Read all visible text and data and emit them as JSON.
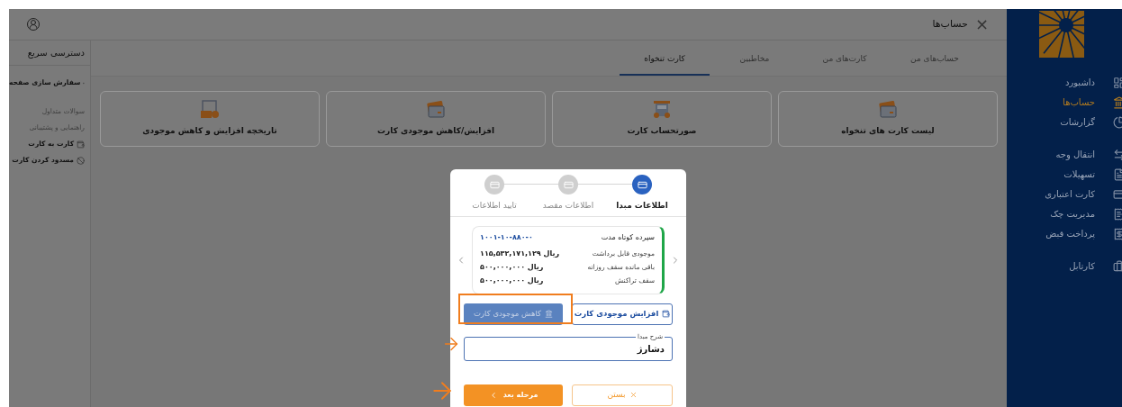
{
  "sidebar": {
    "groups": [
      [
        {
          "label": "داشبورد",
          "selected": false
        },
        {
          "label": "حساب‌ها",
          "selected": true
        },
        {
          "label": "گزارشات",
          "selected": false
        }
      ],
      [
        {
          "label": "انتقال وجه",
          "selected": false
        },
        {
          "label": "تسهیلات",
          "selected": false
        },
        {
          "label": "کارت اعتباری",
          "selected": false
        },
        {
          "label": "مدیریت چک",
          "selected": false
        },
        {
          "label": "پرداخت قبض",
          "selected": false
        }
      ],
      [
        {
          "label": "کارتابل",
          "selected": false
        }
      ]
    ]
  },
  "header": {
    "title": "حساب‌ها",
    "close": "×"
  },
  "tabs": [
    {
      "label": "حساب‌های من",
      "selected": false
    },
    {
      "label": "کارت‌های من",
      "selected": false
    },
    {
      "label": "مخاطبین",
      "selected": false
    },
    {
      "label": "کارت تنخواه",
      "selected": true
    }
  ],
  "cards": [
    {
      "label": "لیست کارت های تنخواه"
    },
    {
      "label": "صورتحساب کارت"
    },
    {
      "label": "افزایش/کاهش موجودی کارت"
    },
    {
      "label": "تاریخچه افزایش و کاهش موجودی"
    }
  ],
  "quick_access": {
    "title": "دسترسی سریع",
    "items": [
      {
        "label": "سفارش سازی صفحه",
        "disabled": false
      },
      {
        "label": "سوالات متداول",
        "disabled": true
      },
      {
        "label": "راهنمایی و پشتیبانی",
        "disabled": true
      },
      {
        "label": "کارت به کارت",
        "disabled": false
      },
      {
        "label": "مسدود کردن کارت",
        "disabled": false
      }
    ]
  },
  "modal": {
    "steps": [
      {
        "label": "اطلاعات مبدا",
        "selected": true
      },
      {
        "label": "اطلاعات مقصد",
        "selected": false
      },
      {
        "label": "تایید اطلاعات",
        "selected": false
      }
    ],
    "account": {
      "title": "سپرده کوتاه مدت",
      "number": "۱۰۰۱-۱۰-۸۸۰-۰",
      "rows": [
        {
          "label": "موجودی قابل برداشت",
          "value": "۱۱۵,۵۳۲,۱۷۱,۱۲۹ ریال"
        },
        {
          "label": "باقی مانده سقف روزانه",
          "value": "۵۰۰,۰۰۰,۰۰۰ ریال"
        },
        {
          "label": "سقف تراکنش",
          "value": "۵۰۰,۰۰۰,۰۰۰ ریال"
        }
      ]
    },
    "options": [
      {
        "label": "افزایش موجودی کارت",
        "selected": false
      },
      {
        "label": "کاهش موجودی کارت",
        "selected": true
      }
    ],
    "description": {
      "label": "شرح مبدا",
      "value": "دشارژ"
    },
    "next_button": "مرحله بعد",
    "close_button": "بستن"
  }
}
